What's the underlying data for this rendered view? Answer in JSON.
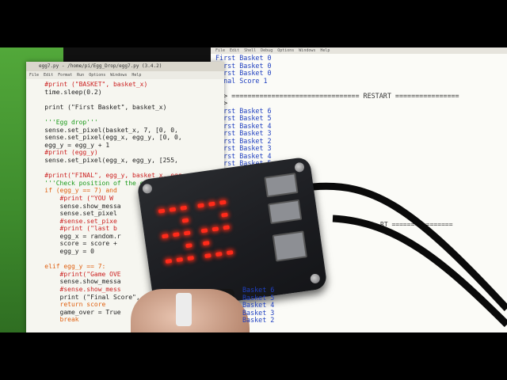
{
  "editor": {
    "title": "egg7.py - /home/pi/Egg_Drop/egg7.py (3.4.2)",
    "menu": [
      "File",
      "Edit",
      "Format",
      "Run",
      "Options",
      "Windows",
      "Help"
    ],
    "lines": [
      "    #print (\"BASKET\", basket_x)",
      "    time.sleep(0.2)",
      "",
      "    print (\"First Basket\", basket_x)",
      "",
      "    '''Egg drop'''",
      "    sense.set_pixel(basket_x, 7, [0, 0,",
      "    sense.set_pixel(egg_x, egg_y, [0, 0,",
      "    egg_y = egg_y + 1",
      "    #print (egg_y)",
      "    sense.set_pixel(egg_x, egg_y, [255,",
      "",
      "    #print(\"FINAL\", egg_y, basket_x, egg",
      "    '''Check position of the egg",
      "    if (egg_y == 7) and",
      "        #print (\"YOU W",
      "        sense.show_messa",
      "        sense.set_pixel",
      "        #sense.set_pixe",
      "        #print (\"last b",
      "        egg_x = random.r",
      "        score = score +",
      "        egg_y = 0",
      "",
      "    elif egg_y == 7:",
      "        #print(\"Game OVE",
      "        sense.show_messa",
      "        #sense.show_mess",
      "        print (\"Final Score\",",
      "        return score",
      "        game_over = True",
      "        break"
    ]
  },
  "shell": {
    "menu": [
      "File",
      "Edit",
      "Shell",
      "Debug",
      "Options",
      "Windows",
      "Help"
    ],
    "lines_top": [
      "First Basket 0",
      "First Basket 0",
      "First Basket 0",
      "Final Score 1",
      "",
      ">>> ================================ RESTART ================",
      ">>>",
      "First Basket 6",
      "First Basket 5",
      "First Basket 4",
      "First Basket 3",
      "First Basket 2",
      "First Basket 3",
      "First Basket 4",
      "First Basket 5"
    ],
    "restart_lower": "RT ================",
    "lines_bottom": [
      "Basket 6",
      "Basket 5",
      "Basket 4",
      "Basket 3",
      "Basket 2"
    ]
  },
  "device": {
    "led_display": "32",
    "led_color": "#ff2a1a"
  }
}
